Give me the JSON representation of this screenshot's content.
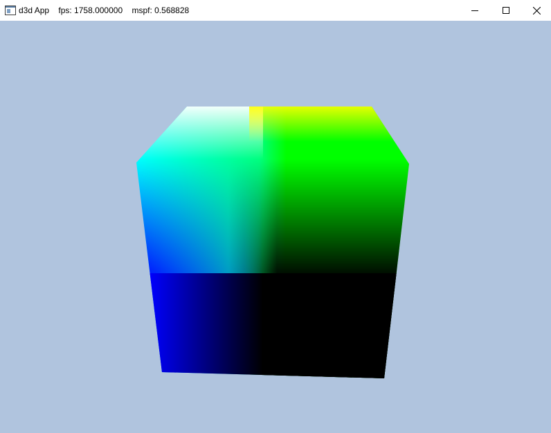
{
  "window": {
    "title": "d3d App    fps: 1758.000000    mspf: 0.568828",
    "icon": "app-window-icon",
    "controls": {
      "minimize_icon": "minimize-icon",
      "maximize_icon": "maximize-icon",
      "close_icon": "close-icon"
    }
  },
  "viewport": {
    "background_color": "#b0c4de",
    "object": "rotating-colored-cube",
    "cube_colors": {
      "white": "#ffffff",
      "yellow": "#ffff00",
      "cyan": "#00ffff",
      "green": "#00ff00",
      "blue": "#0000ff",
      "black": "#000000"
    }
  }
}
